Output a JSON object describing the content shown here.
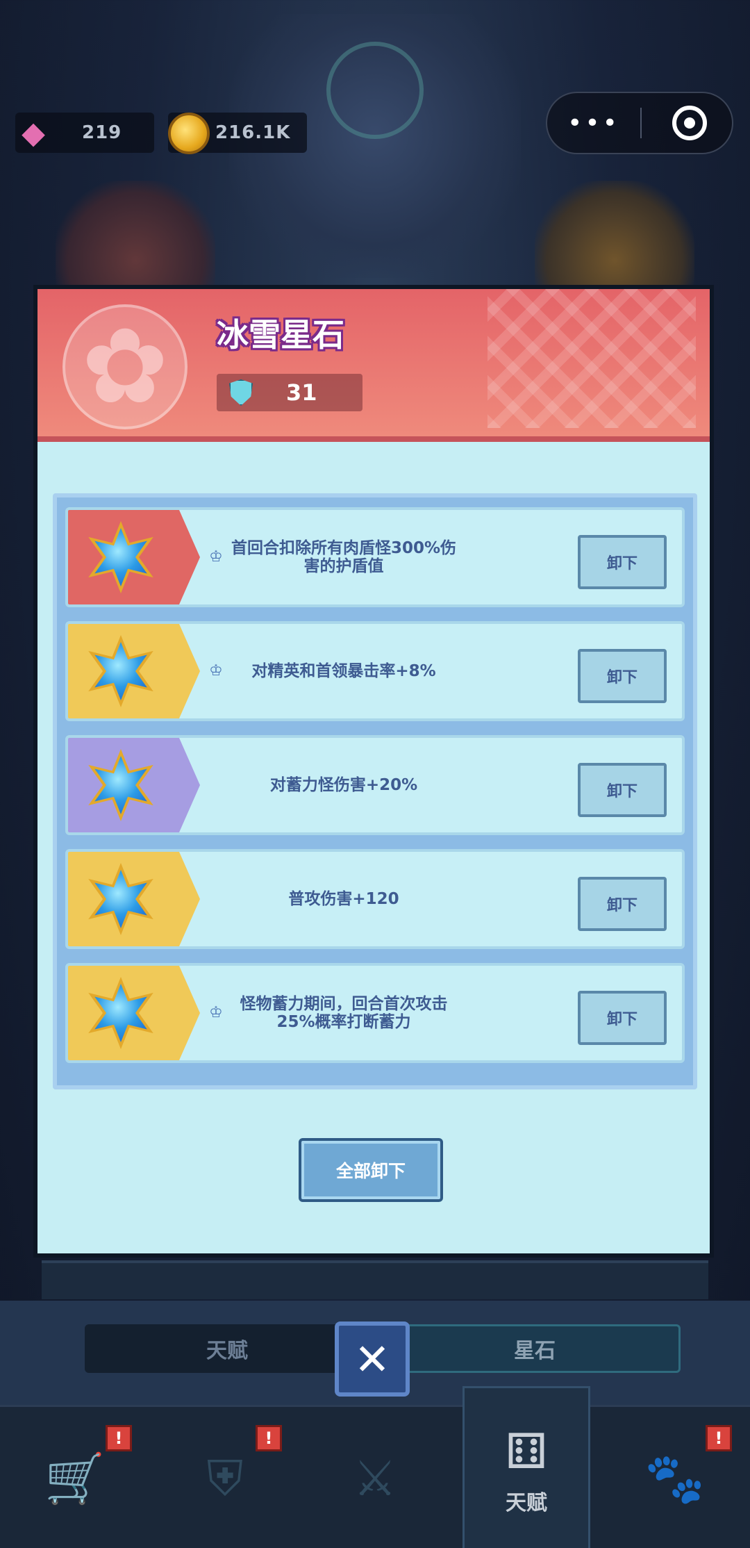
{
  "currency": {
    "gems": "219",
    "coins": "216.1K"
  },
  "header": {
    "title": "冰雪星石",
    "shield_value": "31"
  },
  "skills": [
    {
      "tier": "red",
      "has_crown": true,
      "text": "首回合扣除所有肉盾怪300%伤害的护盾值",
      "button": "卸下"
    },
    {
      "tier": "yellow",
      "has_crown": true,
      "text": "对精英和首领暴击率+8%",
      "button": "卸下"
    },
    {
      "tier": "purple",
      "has_crown": false,
      "text": "对蓄力怪伤害+20%",
      "button": "卸下"
    },
    {
      "tier": "yellow",
      "has_crown": false,
      "text": "普攻伤害+120",
      "button": "卸下"
    },
    {
      "tier": "yellow",
      "has_crown": true,
      "text": "怪物蓄力期间，回合首次攻击25%概率打断蓄力",
      "button": "卸下"
    }
  ],
  "unequip_all_label": "全部卸下",
  "tabs": {
    "left": "天赋",
    "right": "星石"
  },
  "nav": {
    "active_label": "天赋",
    "badge": "!"
  },
  "colors": {
    "header_red": "#e46468",
    "panel_bg": "#c6eef4",
    "tier_red": "#e06764",
    "tier_yellow": "#f0c958",
    "tier_purple": "#a69de2"
  }
}
